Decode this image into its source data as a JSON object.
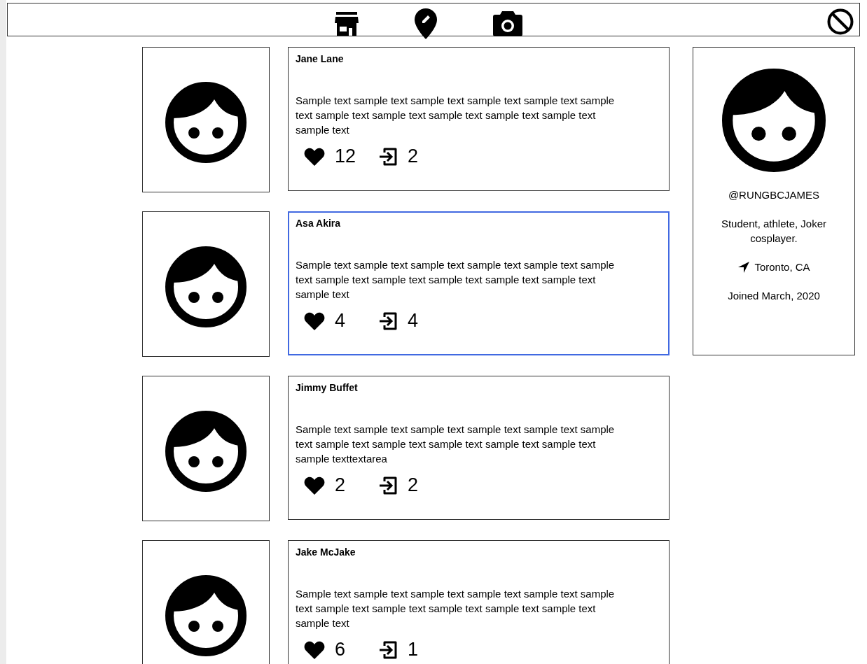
{
  "posts": [
    {
      "author": "Jane Lane",
      "text": "Sample text sample text sample text sample text sample text sample text sample text sample text sample text sample text sample text sample text",
      "likes": "12",
      "shares": "2",
      "selected": false
    },
    {
      "author": "Asa Akira",
      "text": "Sample text sample text sample text sample text sample text sample text sample text sample text sample text sample text sample text sample text",
      "likes": "4",
      "shares": "4",
      "selected": true
    },
    {
      "author": "Jimmy Buffet",
      "text": "Sample text sample text sample text sample text sample text sample text sample text sample text sample text sample text sample text sample texttextarea",
      "likes": "2",
      "shares": "2",
      "selected": false
    },
    {
      "author": "Jake McJake",
      "text": "Sample text sample text sample text sample text sample text sample text sample text sample text sample text sample text sample text sample text",
      "likes": "6",
      "shares": "1",
      "selected": false
    }
  ],
  "profile": {
    "handle": "@RUNGBCJAMES",
    "bio": "Student, athlete, Joker cosplayer.",
    "location": "Toronto, CA",
    "joined": "Joined March, 2020"
  }
}
